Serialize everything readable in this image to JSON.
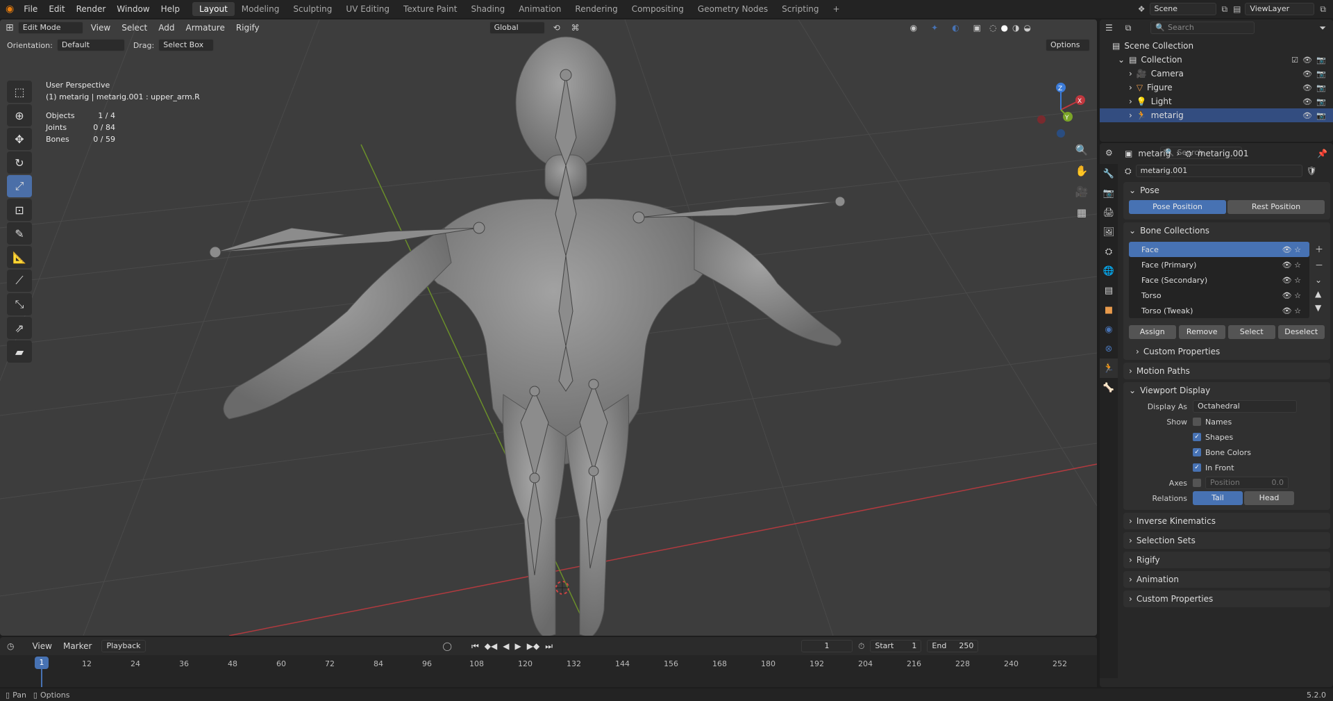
{
  "topbar": {
    "menus": [
      "File",
      "Edit",
      "Render",
      "Window",
      "Help"
    ],
    "workspaces": [
      "Layout",
      "Modeling",
      "Sculpting",
      "UV Editing",
      "Texture Paint",
      "Shading",
      "Animation",
      "Rendering",
      "Compositing",
      "Geometry Nodes",
      "Scripting"
    ],
    "active_workspace": "Layout",
    "add_tab": "+",
    "scene": "Scene",
    "view_layer": "ViewLayer"
  },
  "viewport": {
    "mode": "Edit Mode",
    "menus": [
      "View",
      "Select",
      "Add",
      "Armature",
      "Rigify"
    ],
    "transform_orientation": "Global",
    "orientation_label": "Orientation:",
    "orientation_value": "Default",
    "drag_label": "Drag:",
    "drag_value": "Select Box",
    "options_label": "Options",
    "overlay_title": "User Perspective",
    "overlay_object": "(1) metarig | metarig.001 : upper_arm.R",
    "stats": [
      {
        "label": "Objects",
        "value": "1 / 4"
      },
      {
        "label": "Joints",
        "value": "0 / 84"
      },
      {
        "label": "Bones",
        "value": "0 / 59"
      }
    ],
    "gizmo_axes": [
      "X",
      "Y",
      "Z"
    ]
  },
  "timeline": {
    "menus": [
      "View",
      "Marker",
      "Playback"
    ],
    "current_frame": "1",
    "start_label": "Start",
    "start": "1",
    "end_label": "End",
    "end": "250",
    "frames": [
      "1",
      "12",
      "24",
      "36",
      "48",
      "60",
      "72",
      "84",
      "96",
      "108",
      "120",
      "132",
      "144",
      "156",
      "168",
      "180",
      "192",
      "204",
      "216",
      "228",
      "240",
      "252"
    ]
  },
  "statusbar": {
    "left1": "Pan",
    "left2": "Options",
    "version": "5.2.0"
  },
  "outliner": {
    "search_placeholder": "Search",
    "items": [
      {
        "label": "Scene Collection",
        "indent": 0,
        "selected": false
      },
      {
        "label": "Collection",
        "indent": 1,
        "selected": false
      },
      {
        "label": "Camera",
        "indent": 2,
        "selected": false
      },
      {
        "label": "Figure",
        "indent": 2,
        "selected": false
      },
      {
        "label": "Light",
        "indent": 2,
        "selected": false
      },
      {
        "label": "metarig",
        "indent": 2,
        "selected": true
      }
    ]
  },
  "properties": {
    "search_placeholder": "Search",
    "breadcrumb_object": "metarig",
    "breadcrumb_data": "metarig.001",
    "data_name": "metarig.001",
    "pose_panel": "Pose",
    "pose_position": "Pose Position",
    "rest_position": "Rest Position",
    "bone_collections_panel": "Bone Collections",
    "bone_collections": [
      "Face",
      "Face (Primary)",
      "Face (Secondary)",
      "Torso",
      "Torso (Tweak)"
    ],
    "bc_buttons": [
      "Assign",
      "Remove",
      "Select",
      "Deselect"
    ],
    "custom_properties_sub": "Custom Properties",
    "motion_paths": "Motion Paths",
    "viewport_display": "Viewport Display",
    "display_as_label": "Display As",
    "display_as_value": "Octahedral",
    "show_label": "Show",
    "show_options": [
      {
        "label": "Names",
        "checked": false
      },
      {
        "label": "Shapes",
        "checked": true
      },
      {
        "label": "Bone Colors",
        "checked": true
      },
      {
        "label": "In Front",
        "checked": true
      }
    ],
    "axes_label": "Axes",
    "axes_position_label": "Position",
    "axes_position_value": "0.0",
    "relations_label": "Relations",
    "relations_tail": "Tail",
    "relations_head": "Head",
    "collapsed_panels": [
      "Inverse Kinematics",
      "Selection Sets",
      "Rigify",
      "Animation",
      "Custom Properties"
    ]
  },
  "colors": {
    "accent": "#4772b3",
    "x_axis": "#c0373e",
    "y_axis": "#7ba428",
    "z_axis": "#3b7bd8"
  }
}
